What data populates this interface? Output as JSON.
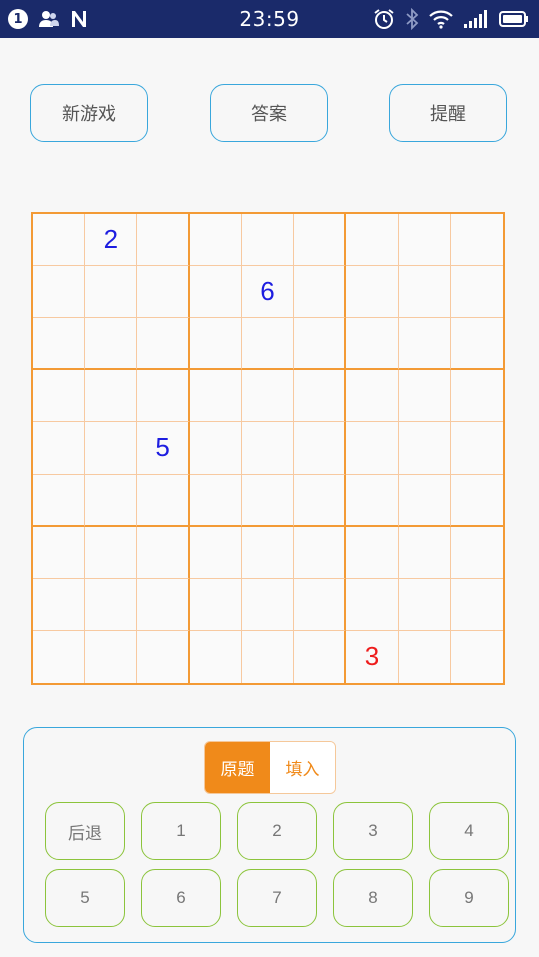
{
  "status_bar": {
    "time": "23:59",
    "notification_count": "1",
    "icons": [
      "notification-badge-icon",
      "contacts-icon",
      "n-app-icon",
      "alarm-icon",
      "bluetooth-icon",
      "wifi-icon",
      "signal-icon",
      "battery-icon"
    ]
  },
  "toolbar": {
    "new_game": "新游戏",
    "answer": "答案",
    "hint": "提醒"
  },
  "board": {
    "given_color": "#1d1de0",
    "filled_color": "#ee1c1c",
    "grid_color": "#f39a35",
    "cells": [
      [
        "",
        "2",
        "",
        "",
        "",
        "",
        "",
        "",
        ""
      ],
      [
        "",
        "",
        "",
        "",
        "6",
        "",
        "",
        "",
        ""
      ],
      [
        "",
        "",
        "",
        "",
        "",
        "",
        "",
        "",
        ""
      ],
      [
        "",
        "",
        "",
        "",
        "",
        "",
        "",
        "",
        ""
      ],
      [
        "",
        "",
        "5",
        "",
        "",
        "",
        "",
        "",
        ""
      ],
      [
        "",
        "",
        "",
        "",
        "",
        "",
        "",
        "",
        ""
      ],
      [
        "",
        "",
        "",
        "",
        "",
        "",
        "",
        "",
        ""
      ],
      [
        "",
        "",
        "",
        "",
        "",
        "",
        "",
        "",
        ""
      ],
      [
        "",
        "",
        "",
        "",
        "",
        "",
        "3",
        "",
        ""
      ]
    ],
    "cell_types": [
      [
        "",
        "given",
        "",
        "",
        "",
        "",
        "",
        "",
        ""
      ],
      [
        "",
        "",
        "",
        "",
        "given",
        "",
        "",
        "",
        ""
      ],
      [
        "",
        "",
        "",
        "",
        "",
        "",
        "",
        "",
        ""
      ],
      [
        "",
        "",
        "",
        "",
        "",
        "",
        "",
        "",
        ""
      ],
      [
        "",
        "",
        "given",
        "",
        "",
        "",
        "",
        "",
        ""
      ],
      [
        "",
        "",
        "",
        "",
        "",
        "",
        "",
        "",
        ""
      ],
      [
        "",
        "",
        "",
        "",
        "",
        "",
        "",
        "",
        ""
      ],
      [
        "",
        "",
        "",
        "",
        "",
        "",
        "",
        "",
        ""
      ],
      [
        "",
        "",
        "",
        "",
        "",
        "",
        "filled",
        "",
        ""
      ]
    ]
  },
  "mode": {
    "original": "原题",
    "fill": "填入",
    "active": "original"
  },
  "keypad": {
    "back": "后退",
    "keys": [
      "1",
      "2",
      "3",
      "4",
      "5",
      "6",
      "7",
      "8",
      "9"
    ]
  }
}
